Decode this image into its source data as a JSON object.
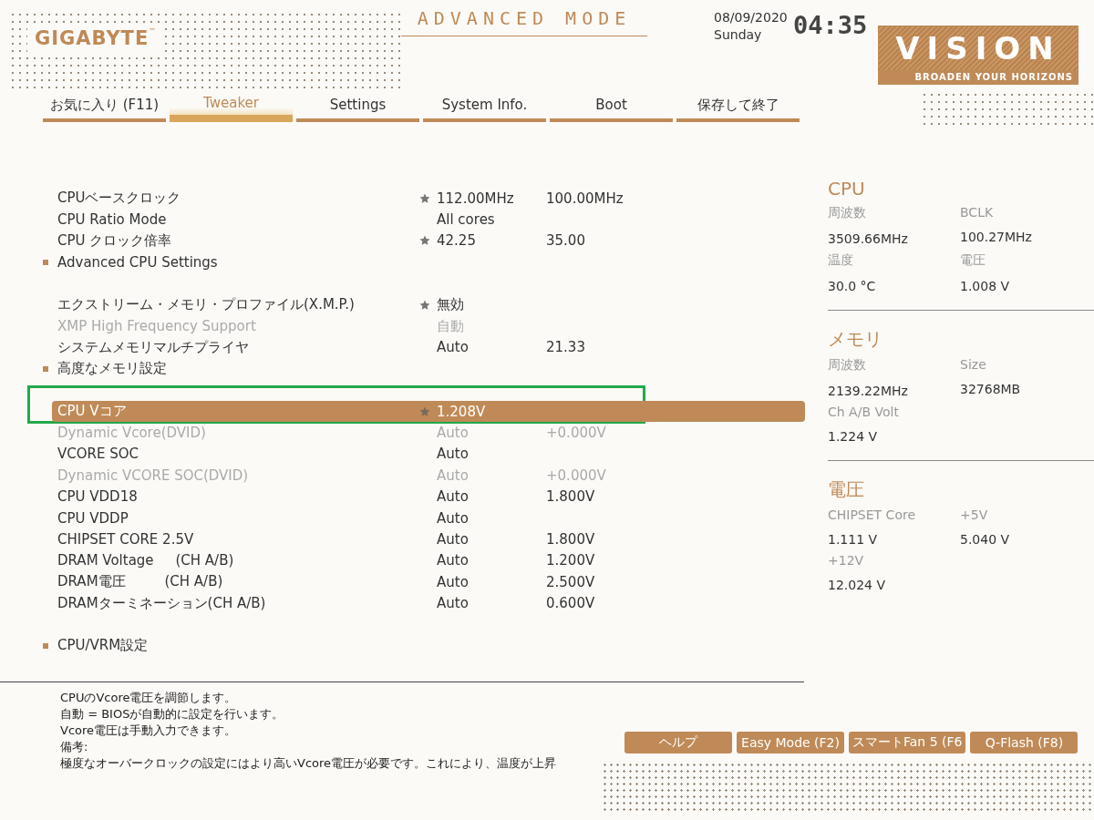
{
  "header": {
    "brand": "GIGABYTE",
    "brand_mark": "™",
    "mode_title": "ADVANCED MODE",
    "date": "08/09/2020",
    "day": "Sunday",
    "time": "04:35",
    "logo_title": "VISION",
    "logo_tagline": "BROADEN YOUR HORIZONS"
  },
  "tabs": [
    {
      "label": "お気に入り (F11)",
      "selected": false
    },
    {
      "label": "Tweaker",
      "selected": true
    },
    {
      "label": "Settings",
      "selected": false
    },
    {
      "label": "System Info.",
      "selected": false
    },
    {
      "label": "Boot",
      "selected": false
    },
    {
      "label": "保存して終了",
      "selected": false
    }
  ],
  "settings": [
    {
      "kind": "item",
      "label": "CPUベースクロック",
      "starred": true,
      "value": "112.00MHz",
      "default": "100.00MHz",
      "disabled": false,
      "selected": false
    },
    {
      "kind": "item",
      "label": "CPU Ratio Mode",
      "starred": false,
      "value": "All cores",
      "disabled": false,
      "selected": false
    },
    {
      "kind": "item",
      "label": "CPU クロック倍率",
      "starred": true,
      "value": "42.25",
      "default": "35.00",
      "disabled": false,
      "selected": false
    },
    {
      "kind": "submenu",
      "label": "Advanced CPU Settings"
    },
    {
      "kind": "spacer"
    },
    {
      "kind": "item",
      "label": "エクストリーム・メモリ・プロファイル(X.M.P.)",
      "starred": true,
      "value": "無効",
      "disabled": false,
      "selected": false
    },
    {
      "kind": "item",
      "label": "XMP High Frequency Support",
      "starred": false,
      "value": "自動",
      "disabled": true,
      "selected": false
    },
    {
      "kind": "item",
      "label": "システムメモリマルチプライヤ",
      "starred": false,
      "value": "Auto",
      "default": "21.33",
      "disabled": false,
      "selected": false
    },
    {
      "kind": "submenu",
      "label": "高度なメモリ設定"
    },
    {
      "kind": "spacer"
    },
    {
      "kind": "item",
      "label": "CPU Vコア",
      "starred": true,
      "value": "1.208V",
      "disabled": false,
      "selected": true
    },
    {
      "kind": "item",
      "label": "Dynamic Vcore(DVID)",
      "starred": false,
      "value": "Auto",
      "default": "+0.000V",
      "disabled": true,
      "selected": false
    },
    {
      "kind": "item",
      "label": "VCORE SOC",
      "starred": false,
      "value": "Auto",
      "disabled": false,
      "selected": false
    },
    {
      "kind": "item",
      "label": "Dynamic VCORE SOC(DVID)",
      "starred": false,
      "value": "Auto",
      "default": "+0.000V",
      "disabled": true,
      "selected": false
    },
    {
      "kind": "item",
      "label": "CPU VDD18",
      "starred": false,
      "value": "Auto",
      "default": "1.800V",
      "disabled": false,
      "selected": false
    },
    {
      "kind": "item",
      "label": "CPU VDDP",
      "starred": false,
      "value": "Auto",
      "disabled": false,
      "selected": false
    },
    {
      "kind": "item",
      "label": "CHIPSET CORE 2.5V",
      "starred": false,
      "value": "Auto",
      "default": "1.800V",
      "disabled": false,
      "selected": false
    },
    {
      "kind": "item",
      "label": "DRAM Voltage     (CH A/B)",
      "starred": false,
      "value": "Auto",
      "default": "1.200V",
      "disabled": false,
      "selected": false
    },
    {
      "kind": "item",
      "label": "DRAM電圧         (CH A/B)",
      "starred": false,
      "value": "Auto",
      "default": "2.500V",
      "disabled": false,
      "selected": false
    },
    {
      "kind": "item",
      "label": "DRAMターミネーション(CH A/B)",
      "starred": false,
      "value": "Auto",
      "default": "0.600V",
      "disabled": false,
      "selected": false
    },
    {
      "kind": "spacer"
    },
    {
      "kind": "submenu",
      "label": "CPU/VRM設定"
    }
  ],
  "info_panel": [
    {
      "title": "CPU",
      "fields": [
        {
          "label": "周波数",
          "value": "3509.66MHz"
        },
        {
          "label": "BCLK",
          "value": "100.27MHz"
        },
        {
          "label": "温度",
          "value": "30.0 °C"
        },
        {
          "label": "電圧",
          "value": "1.008 V"
        }
      ]
    },
    {
      "title": "メモリ",
      "fields": [
        {
          "label": "周波数",
          "value": "2139.22MHz"
        },
        {
          "label": "Size",
          "value": "32768MB"
        },
        {
          "label": "Ch A/B Volt",
          "value": "1.224 V"
        }
      ]
    },
    {
      "title": "電圧",
      "fields": [
        {
          "label": "CHIPSET Core",
          "value": "1.111 V"
        },
        {
          "label": "+5V",
          "value": "5.040 V"
        },
        {
          "label": "+12V",
          "value": "12.024 V"
        }
      ]
    }
  ],
  "help_text": [
    "CPUのVcore電圧を調節します。",
    "自動 = BIOSが自動的に設定を行います。",
    "Vcore電圧は手動入力できます。",
    "備考:",
    "極度なオーバークロックの設定にはより高いVcore電圧が必要です。これにより、温度が上昇"
  ],
  "buttons": [
    "ヘルプ",
    "Easy Mode (F2)",
    "スマートFan 5 (F6",
    "Q-Flash (F8)"
  ]
}
